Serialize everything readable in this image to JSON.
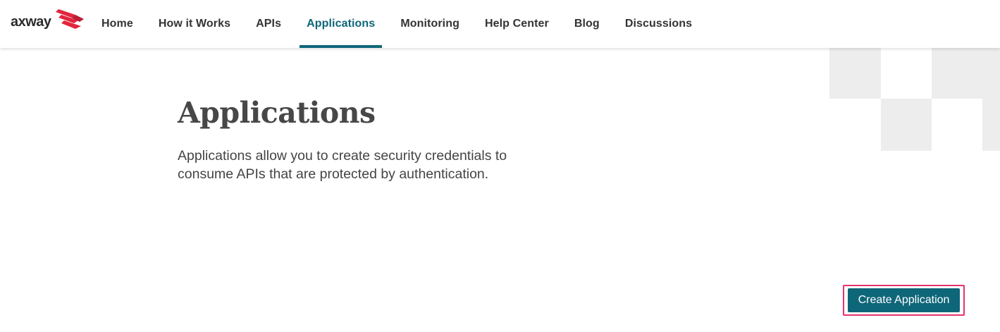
{
  "brand": {
    "logo_text": "axway",
    "accent_color": "#e2253d"
  },
  "nav": {
    "items": [
      {
        "label": "Home"
      },
      {
        "label": "How it Works"
      },
      {
        "label": "APIs"
      },
      {
        "label": "Applications",
        "active": true
      },
      {
        "label": "Monitoring"
      },
      {
        "label": "Help Center"
      },
      {
        "label": "Blog"
      },
      {
        "label": "Discussions"
      }
    ],
    "active_color": "#0e6679"
  },
  "main": {
    "title": "Applications",
    "description": "Applications allow you to create security credentials to consume APIs that are protected by authentication.",
    "create_button_label": "Create Application",
    "button_color": "#0e6679",
    "highlight_color": "#e3336e"
  }
}
